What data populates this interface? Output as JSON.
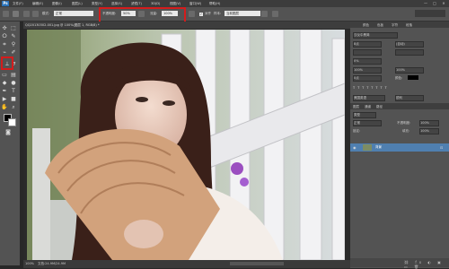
{
  "menubar": {
    "logo": "Ps",
    "items": [
      "文件(F)",
      "编辑(E)",
      "图像(I)",
      "图层(L)",
      "类型(Y)",
      "选择(S)",
      "滤镜(T)",
      "3D(D)",
      "视图(V)",
      "窗口(W)",
      "帮助(H)"
    ],
    "minimize": "—",
    "maximize": "□",
    "close": "✕"
  },
  "options": {
    "mode_label": "模式:",
    "mode_value": "正常",
    "opacity_label": "不透明度:",
    "opacity_value": "50%",
    "flow_label": "流量:",
    "flow_value": "100%",
    "aligned_label": "对齐",
    "sample_label": "样本:",
    "sample_value": "当前图层"
  },
  "document": {
    "tab_title": "QQ20130302-001.jpg @ 100%(图层 1, RGB/8) *",
    "zoom": "100%",
    "doc_info": "文档:24.9M/24.9M"
  },
  "panels": {
    "top_tabs": [
      "颜色",
      "色板",
      "字符",
      "段落"
    ],
    "font_family": "汉仪中黑简",
    "font_size": "8点",
    "leading": "(自动)",
    "percent_a": "0%",
    "scale_v": "100%",
    "scale_h": "100%",
    "baseline": "0点",
    "color_label": "颜色:",
    "lang": "美国英语",
    "aa": "锐利",
    "layers_tabs": [
      "图层",
      "通道",
      "路径"
    ],
    "filter_kind": "类型",
    "blend_mode": "正常",
    "opacity_label": "不透明度:",
    "opacity_value": "100%",
    "fill_label": "填充:",
    "fill_value": "100%",
    "lock_label": "锁定:",
    "layer_name": "背景"
  }
}
